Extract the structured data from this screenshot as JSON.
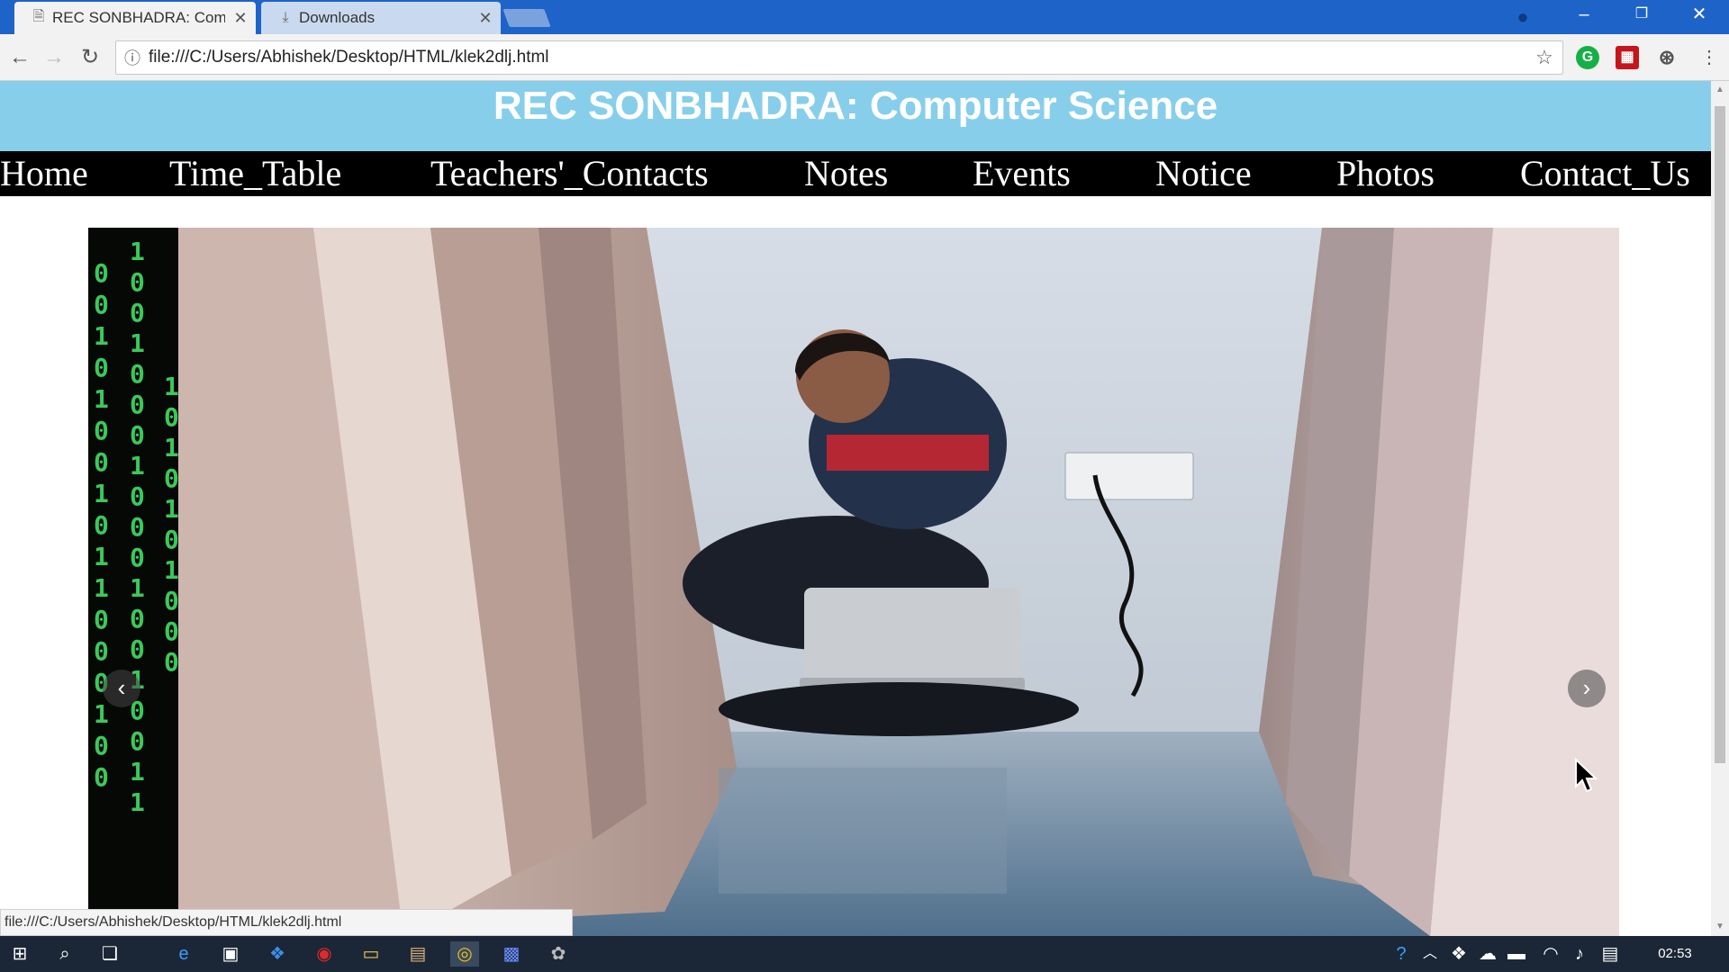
{
  "browser": {
    "tabs": [
      {
        "label": "REC SONBHADRA: Comp",
        "icon": "page-icon",
        "active": true
      },
      {
        "label": "Downloads",
        "icon": "download-icon",
        "active": false
      }
    ],
    "address": "file:///C:/Users/Abhishek/Desktop/HTML/klek2dlj.html",
    "status_url": "file:///C:/Users/Abhishek/Desktop/HTML/klek2dlj.html"
  },
  "page": {
    "title": "REC SONBHADRA: Computer Science",
    "nav": [
      "Home",
      "Time_Table",
      "Teachers'_Contacts",
      "Notes",
      "Events",
      "Notice",
      "Photos",
      "Contact_Us"
    ],
    "header_color": "#87ceeb",
    "nav_color": "#000000"
  },
  "slideshow": {
    "prev_glyph": "‹",
    "next_glyph": "›"
  },
  "taskbar": {
    "clock": "02:53"
  }
}
